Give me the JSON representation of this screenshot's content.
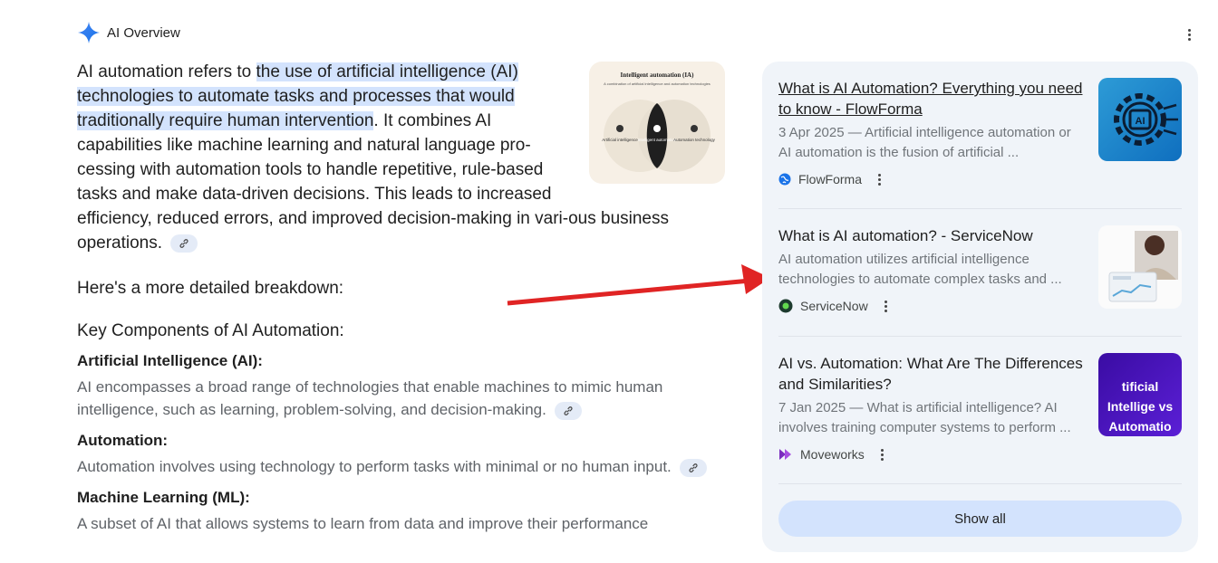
{
  "header": {
    "title": "AI Overview"
  },
  "intro": {
    "lead": "AI automation refers to ",
    "highlight": "the use of artificial intelligence (AI) technologies to automate tasks and processes that would traditionally require human intervention",
    "rest": ". It combines AI capabilities like machine learning and natural language pro-cessing with automation tools to handle repetitive, rule-based tasks and make data-driven decisions. This leads to increased efficiency, reduced errors, and improved decision-making in vari-ous business operations."
  },
  "figure": {
    "title": "Intelligent automation (IA)",
    "subtitle": "A combination of artificial intelligence and automation technologies",
    "left_label": "Artificial intelligence",
    "center_label": "Intelligent automation",
    "right_label": "Automation technology"
  },
  "breakdown": "Here's a more detailed breakdown:",
  "section_title": "Key Components of AI Automation:",
  "components": [
    {
      "name": "Artificial Intelligence (AI):",
      "desc": "AI encompasses a broad range of technologies that enable machines to mimic human intelligence, such as learning, problem-solving, and decision-making."
    },
    {
      "name": "Automation:",
      "desc": "Automation involves using technology to perform tasks with minimal or no human input."
    },
    {
      "name": "Machine Learning (ML):",
      "desc": "A subset of AI that allows systems to learn from data and improve their performance"
    }
  ],
  "sources": [
    {
      "title": "What is AI Automation? Everything you need to know - FlowForma",
      "snippet": "3 Apr 2025 — Artificial intelligence automation or AI automation is the fusion of artificial ...",
      "site": "FlowForma",
      "icon": "globe-icon"
    },
    {
      "title": "What is AI automation? - ServiceNow",
      "snippet": "AI automation utilizes artificial intelligence technologies to automate complex tasks and ...",
      "site": "ServiceNow",
      "icon": "servicenow-icon"
    },
    {
      "title": "AI vs. Automation: What Are The Differences and Similarities?",
      "snippet": "7 Jan 2025 — What is artificial intelligence? AI involves training computer systems to perform ...",
      "site": "Moveworks",
      "icon": "moveworks-icon",
      "thumb_text": "tificial Intellige vs Automatio"
    }
  ],
  "show_all": "Show all",
  "colors": {
    "highlight": "#d3e3fd",
    "panel": "#f0f4f9",
    "arrow": "#e02424"
  }
}
